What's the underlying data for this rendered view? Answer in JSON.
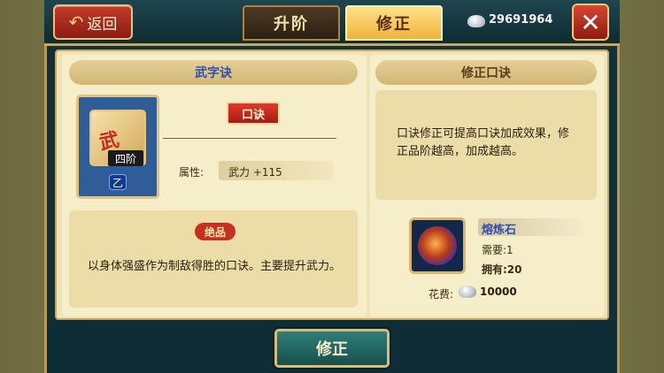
{
  "header": {
    "back_label": "返回",
    "tabs": [
      {
        "label": "升阶",
        "active": false
      },
      {
        "label": "修正",
        "active": true
      }
    ],
    "currency_value": "29691964",
    "close_glyph": "✕"
  },
  "left": {
    "title": "武字诀",
    "item_char": "武",
    "item_rank": "四阶",
    "item_grade": "乙",
    "seal_label": "口诀",
    "attr_label": "属性:",
    "attr_value": "武力 +115",
    "quality_label": "绝品",
    "description": "以身体强盛作为制敌得胜的口诀。主要提升武力。"
  },
  "right": {
    "title": "修正口诀",
    "description": "口诀修正可提高口诀加成效果，修正品阶越高，加成越高。",
    "material_name": "熔炼石",
    "need": "需要:1",
    "own": "拥有:20",
    "cost_label": "花费:",
    "cost_value": "10000"
  },
  "footer": {
    "confirm_label": "修正"
  },
  "colors": {
    "accent_gold": "#c9a75f",
    "tab_active": "#f0b43a",
    "title_blue": "#2e4fb0",
    "close_red": "#d9452f"
  }
}
